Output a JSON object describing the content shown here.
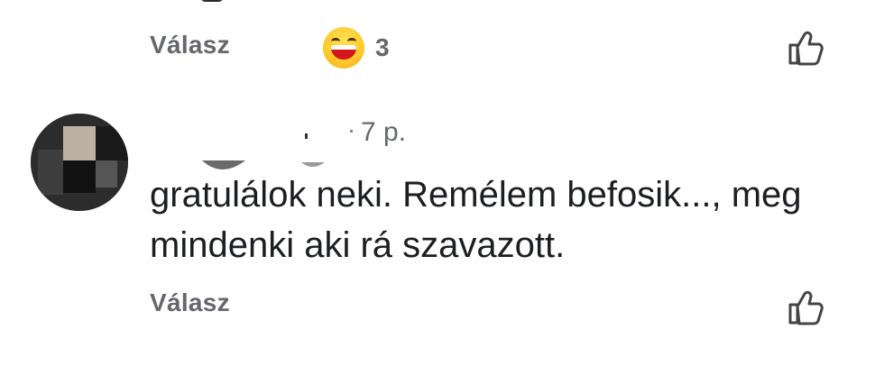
{
  "previous_comment": {
    "reply_label": "Válasz",
    "reaction": {
      "icon": "laughing-emoji-icon",
      "count": "3"
    },
    "like_icon": "thumbs-up-icon"
  },
  "comment": {
    "author_name": "",
    "timestamp": "7 p.",
    "text_lines": [
      "gratulálok neki. Remélem befosik..., meg",
      "mindenki aki rá szavazott."
    ],
    "reply_label": "Válasz",
    "like_icon": "thumbs-up-icon"
  },
  "colors": {
    "secondary_text": "#65676b",
    "primary_text": "#1c1e21",
    "background": "#ffffff"
  }
}
